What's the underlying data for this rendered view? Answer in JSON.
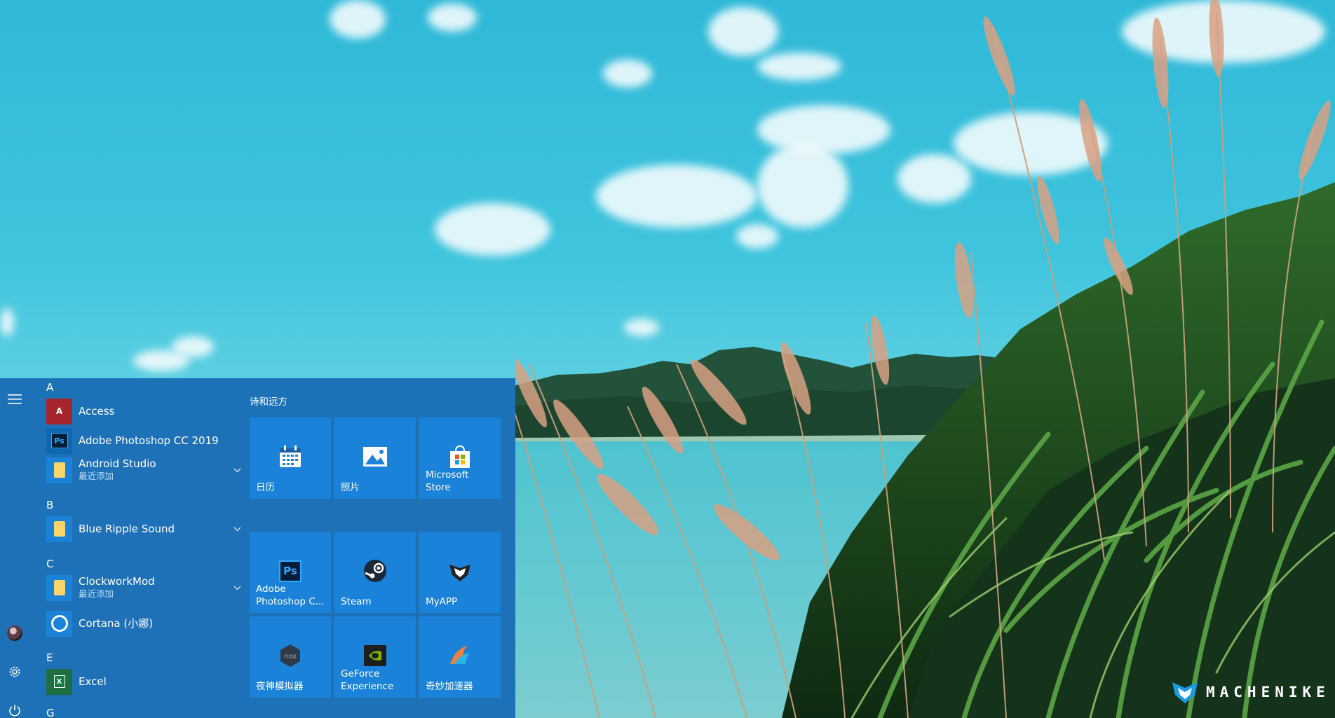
{
  "desktop": {
    "brand": "MACHENIKE"
  },
  "start_menu": {
    "app_list": [
      {
        "letter": "A"
      },
      {
        "name": "Access",
        "icon": "access-icon"
      },
      {
        "name": "Adobe Photoshop CC 2019",
        "icon": "photoshop-icon"
      },
      {
        "name": "Android Studio",
        "sub": "最近添加",
        "icon": "folder-icon",
        "expandable": true
      },
      {
        "letter": "B"
      },
      {
        "name": "Blue Ripple Sound",
        "icon": "folder-icon",
        "expandable": true
      },
      {
        "letter": "C"
      },
      {
        "name": "ClockworkMod",
        "sub": "最近添加",
        "icon": "folder-icon",
        "expandable": true
      },
      {
        "name": "Cortana (小娜)",
        "icon": "cortana-icon"
      },
      {
        "letter": "E"
      },
      {
        "name": "Excel",
        "icon": "excel-icon"
      },
      {
        "letter": "G"
      }
    ],
    "tile_group_title": "诗和远方",
    "tiles": [
      {
        "label": "日历",
        "icon": "calendar-icon"
      },
      {
        "label": "照片",
        "icon": "photos-icon"
      },
      {
        "label": "Microsoft Store",
        "icon": "store-icon"
      },
      {
        "label": "Adobe Photoshop C...",
        "icon": "photoshop-icon"
      },
      {
        "label": "Steam",
        "icon": "steam-icon"
      },
      {
        "label": "MyAPP",
        "icon": "myapp-icon"
      },
      {
        "label": "夜神模拟器",
        "icon": "nox-icon"
      },
      {
        "label": "GeForce Experience",
        "icon": "geforce-icon"
      },
      {
        "label": "奇妙加速器",
        "icon": "accelerator-icon"
      }
    ]
  }
}
